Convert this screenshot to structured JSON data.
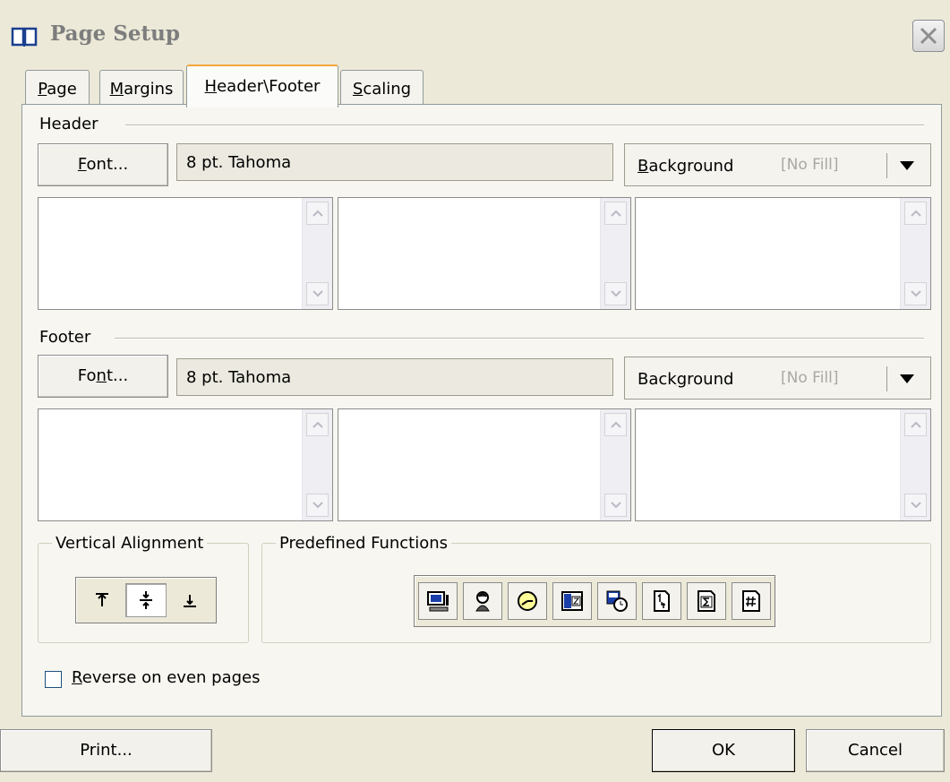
{
  "window": {
    "title": "Page Setup"
  },
  "tabs": [
    "Page",
    "Margins",
    "Header\\Footer",
    "Scaling"
  ],
  "header": {
    "group_label": "Header",
    "font_button": "Font...",
    "font_value": "8 pt. Tahoma",
    "background_label": "Background",
    "background_value": "[No Fill]"
  },
  "footer": {
    "group_label": "Footer",
    "font_button": "Font...",
    "font_value": "8 pt. Tahoma",
    "background_label": "Background",
    "background_value": "[No Fill]"
  },
  "vertical_alignment": {
    "label": "Vertical Alignment",
    "options": [
      "top-align-icon",
      "center-align-icon",
      "bottom-align-icon"
    ],
    "selected": 1
  },
  "predefined_functions": {
    "label": "Predefined Functions",
    "icons": [
      "computer-name-icon",
      "user-name-icon",
      "time-icon",
      "date-icon",
      "date-time-icon",
      "page-number-icon",
      "total-pages-icon",
      "page-count-icon"
    ]
  },
  "reverse_checkbox": {
    "label": "Reverse on even pages",
    "checked": false
  },
  "buttons": {
    "print": "Print...",
    "ok": "OK",
    "cancel": "Cancel"
  }
}
